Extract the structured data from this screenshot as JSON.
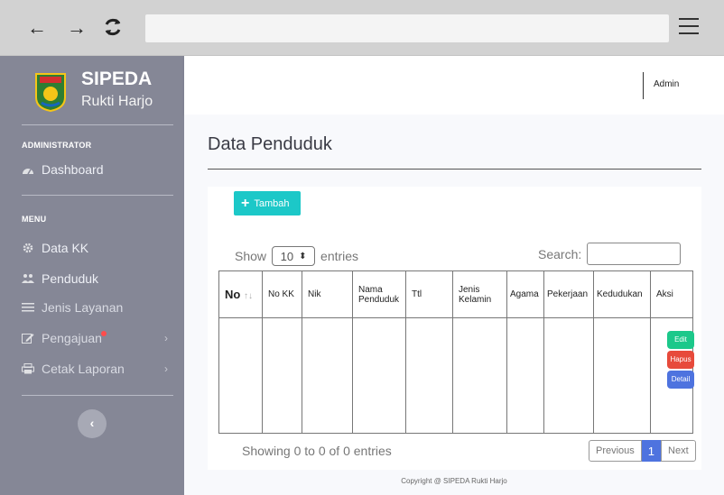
{
  "browser": {
    "back_icon": "←",
    "forward_icon": "→",
    "url": ""
  },
  "sidebar": {
    "brand_title": "SIPEDA",
    "brand_subtitle": "Rukti Harjo",
    "section_admin": "ADMINISTRATOR",
    "section_menu": "MENU",
    "items": [
      {
        "label": "Dashboard",
        "icon": "dashboard-icon"
      },
      {
        "label": "Data KK",
        "icon": "gear-icon"
      },
      {
        "label": "Penduduk",
        "icon": "users-icon"
      },
      {
        "label": "Jenis Layanan",
        "icon": "list-icon"
      },
      {
        "label": "Pengajuan",
        "icon": "edit-icon"
      },
      {
        "label": "Cetak Laporan",
        "icon": "print-icon"
      }
    ],
    "chevron": "›",
    "toggle": "‹"
  },
  "topbar": {
    "user": "Admin"
  },
  "page": {
    "title": "Data Penduduk",
    "add_button": "Tambah",
    "show_label": "Show",
    "entries_value": "10",
    "entries_label": "entries",
    "search_label": "Search:",
    "search_value": "",
    "info": "Showing 0 to 0 of 0 entries",
    "pagination": {
      "previous": "Previous",
      "current": "1",
      "next": "Next"
    }
  },
  "table": {
    "headers": [
      "No",
      "No KK",
      "Nik",
      "Nama Penduduk",
      "Ttl",
      "Jenis Kelamin",
      "Agama",
      "Pekerjaan",
      "Kedudukan",
      "Aksi"
    ],
    "actions": {
      "edit": "Edit",
      "hapus": "Hapus",
      "detail": "Detail"
    }
  },
  "footer": "Copyright @ SIPEDA Rukti Harjo",
  "colors": {
    "sidebar": "#858796",
    "add_button": "#1cc8c8",
    "edit": "#1cc88a",
    "hapus": "#e74a3b",
    "detail": "#4e73df",
    "badge": "#ff4c4c"
  }
}
